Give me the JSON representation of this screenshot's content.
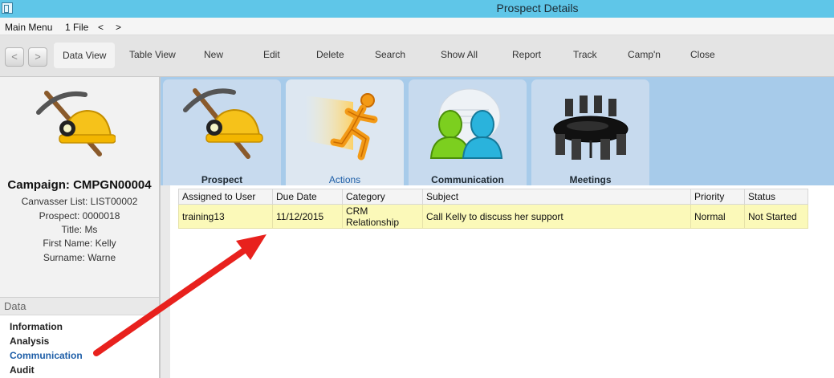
{
  "window": {
    "title": "Prospect Details"
  },
  "menu": {
    "main_menu": "Main Menu",
    "file": "1 File",
    "prev": "<",
    "next": ">"
  },
  "toolbar": {
    "back": "<",
    "forward": ">",
    "data_view": "Data View",
    "table_view": "Table View",
    "new": "New",
    "edit": "Edit",
    "delete": "Delete",
    "search": "Search",
    "show_all": "Show All",
    "report": "Report",
    "track": "Track",
    "campn": "Camp'n",
    "close": "Close"
  },
  "prospect": {
    "campaign": "Campaign: CMPGN00004",
    "canvasser_list": "Canvasser List: LIST00002",
    "prospect": "Prospect: 0000018",
    "title": "Title: Ms",
    "first_name": "First Name: Kelly",
    "surname": "Surname: Warne"
  },
  "sidebar": {
    "section_header": "Data",
    "items": [
      {
        "label": "Information",
        "active": false
      },
      {
        "label": "Analysis",
        "active": false
      },
      {
        "label": "Communication",
        "active": true
      },
      {
        "label": "Audit",
        "active": false
      }
    ]
  },
  "tabs": [
    {
      "label": "Prospect",
      "icon": "miner-helmet-icon",
      "active": false
    },
    {
      "label": "Actions",
      "icon": "running-man-icon",
      "active": true
    },
    {
      "label": "Communication",
      "icon": "people-talking-icon",
      "active": false
    },
    {
      "label": "Meetings",
      "icon": "meeting-table-icon",
      "active": false
    }
  ],
  "actions_grid": {
    "columns": [
      "Assigned to User",
      "Due Date",
      "Category",
      "Subject",
      "Priority",
      "Status"
    ],
    "rows": [
      {
        "assigned_to_user": "training13",
        "due_date": "11/12/2015",
        "category": "CRM Relationship",
        "subject": "Call Kelly to discuss her support",
        "priority": "Normal",
        "status": "Not Started"
      }
    ]
  },
  "colors": {
    "titlebar": "#5fc6e8",
    "tabstrip": "#a7cbea",
    "row_highlight": "#fbf9b9",
    "active_link": "#1f5fa8",
    "annotation_arrow": "#e8211d"
  }
}
